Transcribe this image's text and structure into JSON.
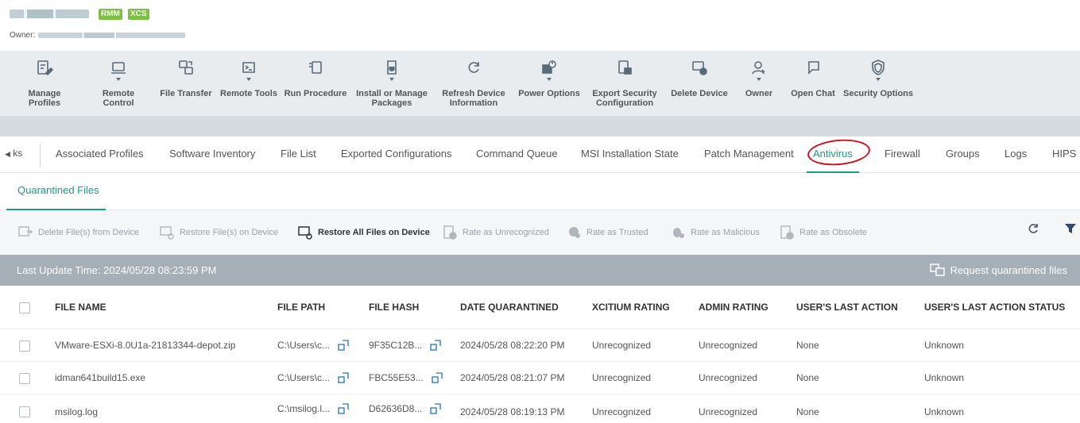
{
  "header": {
    "badges": [
      "RMM",
      "XCS"
    ],
    "owner_label": "Owner:"
  },
  "toolbar": {
    "buttons": [
      {
        "label": "Manage Profiles",
        "icon": "manage-profiles-icon",
        "dropdown": false
      },
      {
        "label": "Remote Control",
        "icon": "laptop-icon",
        "dropdown": true
      },
      {
        "label": "File Transfer",
        "icon": "file-transfer-icon",
        "dropdown": false
      },
      {
        "label": "Remote Tools",
        "icon": "remote-tools-icon",
        "dropdown": true
      },
      {
        "label": "Run Procedure",
        "icon": "run-procedure-icon",
        "dropdown": false
      },
      {
        "label": "Install or Manage Packages",
        "icon": "package-icon",
        "dropdown": true
      },
      {
        "label": "Refresh Device Information",
        "icon": "refresh-icon",
        "dropdown": false
      },
      {
        "label": "Power Options",
        "icon": "power-options-icon",
        "dropdown": true
      },
      {
        "label": "Export Security Configuration",
        "icon": "export-icon",
        "dropdown": false
      },
      {
        "label": "Delete Device",
        "icon": "delete-device-icon",
        "dropdown": false
      },
      {
        "label": "Owner",
        "icon": "owner-icon",
        "dropdown": true
      },
      {
        "label": "Open Chat",
        "icon": "chat-icon",
        "dropdown": false
      },
      {
        "label": "Security Options",
        "icon": "shield-icon",
        "dropdown": true
      }
    ]
  },
  "tabs": {
    "scroll_stub": "ks",
    "items": [
      "Associated Profiles",
      "Software Inventory",
      "File List",
      "Exported Configurations",
      "Command Queue",
      "MSI Installation State",
      "Patch Management",
      "Antivirus",
      "Firewall",
      "Groups",
      "Logs",
      "HIPS"
    ],
    "active": "Antivirus"
  },
  "subtabs": {
    "active": "Quarantined Files"
  },
  "actions": {
    "delete": "Delete File(s) from Device",
    "restore": "Restore File(s) on Device",
    "restore_all": "Restore All Files on Device",
    "rate_unrecognized": "Rate as Unrecognized",
    "rate_trusted": "Rate as Trusted",
    "rate_malicious": "Rate as Malicious",
    "rate_obsolete": "Rate as Obsolete"
  },
  "status": {
    "last_update": "Last Update Time: 2024/05/28 08:23:59 PM",
    "request": "Request quarantined files"
  },
  "table": {
    "headers": [
      "FILE NAME",
      "FILE PATH",
      "FILE HASH",
      "DATE QUARANTINED",
      "XCITIUM RATING",
      "ADMIN RATING",
      "USER'S LAST ACTION",
      "USER'S LAST ACTION STATUS"
    ],
    "rows": [
      [
        "VMware-ESXi-8.0U1a-21813344-depot.zip",
        "C:\\Users\\c...",
        "9F35C12B...",
        "2024/05/28 08:22:20 PM",
        "Unrecognized",
        "Unrecognized",
        "None",
        "Unknown"
      ],
      [
        "idman641build15.exe",
        "C:\\Users\\c...",
        "FBC55E53...",
        "2024/05/28 08:21:07 PM",
        "Unrecognized",
        "Unrecognized",
        "None",
        "Unknown"
      ],
      [
        "msilog.log",
        "C:\\msilog.l...",
        "D62636D8...",
        "2024/05/28 08:19:13 PM",
        "Unrecognized",
        "Unrecognized",
        "None",
        "Unknown"
      ]
    ]
  },
  "colors": {
    "accent": "#1d9b8a",
    "badge": "#7cc242",
    "highlight_circle": "#d0101f",
    "status_bar": "#a4afb8"
  }
}
